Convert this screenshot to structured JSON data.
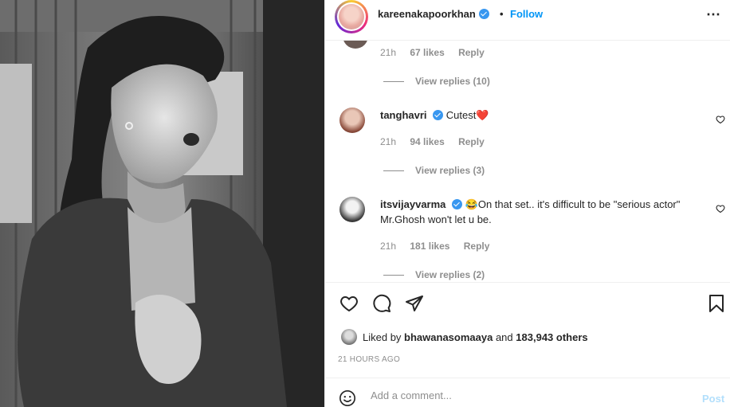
{
  "header": {
    "username": "kareenakapoorkhan",
    "separator": "•",
    "follow_label": "Follow",
    "more_label": "⋯"
  },
  "comments": [
    {
      "user": "",
      "text": "",
      "time": "21h",
      "likes": "67 likes",
      "reply_label": "Reply",
      "view_replies": "View replies (10)"
    },
    {
      "user": "tanghavri",
      "text": "Cutest",
      "emoji": "❤️",
      "time": "21h",
      "likes": "94 likes",
      "reply_label": "Reply",
      "view_replies": "View replies (3)"
    },
    {
      "user": "itsvijayvarma",
      "emoji": "😂",
      "text": "On that set.. it's difficult to be \"serious actor\" Mr.Ghosh won't let u be.",
      "time": "21h",
      "likes": "181 likes",
      "reply_label": "Reply",
      "view_replies": "View replies (2)"
    }
  ],
  "actions": {
    "like_icon": "heart-icon",
    "comment_icon": "comment-icon",
    "share_icon": "share-icon",
    "save_icon": "bookmark-icon"
  },
  "likes": {
    "prefix": "Liked by",
    "user": "bhawanasomaaya",
    "middle": "and",
    "others": "183,943 others"
  },
  "time_ago": "21 HOURS AGO",
  "add_comment": {
    "placeholder": "Add a comment...",
    "post_label": "Post"
  },
  "colors": {
    "accent": "#0095f6",
    "post_disabled": "#b2dffc",
    "muted": "#8e8e8e",
    "verified": "#3897f0"
  }
}
